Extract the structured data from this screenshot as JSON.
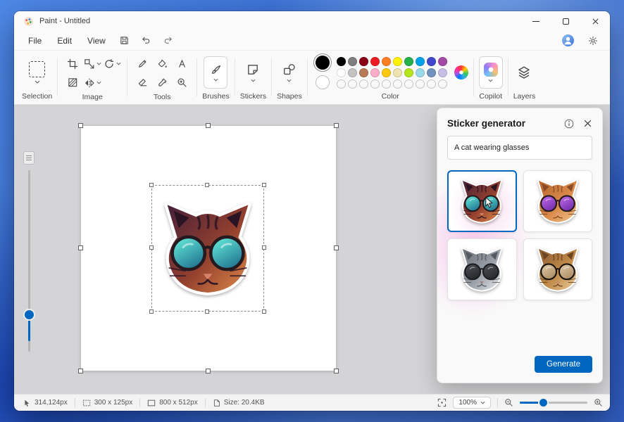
{
  "titlebar": {
    "title": "Paint - Untitled"
  },
  "menubar": {
    "items": [
      {
        "label": "File"
      },
      {
        "label": "Edit"
      },
      {
        "label": "View"
      }
    ]
  },
  "ribbon": {
    "group_labels": {
      "selection": "Selection",
      "image": "Image",
      "tools": "Tools",
      "brushes": "Brushes",
      "stickers": "Stickers",
      "shapes": "Shapes",
      "color": "Color",
      "copilot": "Copilot",
      "layers": "Layers"
    },
    "palette": {
      "foreground": "#000000",
      "background": "#ffffff",
      "row1": [
        "#000000",
        "#7f7f7f",
        "#880015",
        "#ed1c24",
        "#ff7f27",
        "#fff200",
        "#22b14c",
        "#00a2e8",
        "#3f48cc",
        "#a349a4"
      ],
      "row2": [
        "#ffffff",
        "#c3c3c3",
        "#b97a57",
        "#ffaec9",
        "#ffc90e",
        "#efe4b0",
        "#b5e61d",
        "#99d9ea",
        "#7092be",
        "#c8bfe7"
      ],
      "empty_slots": 10
    }
  },
  "sticker_panel": {
    "title": "Sticker generator",
    "prompt": "A cat wearing glasses",
    "generate_label": "Generate",
    "accent": "#0067c0",
    "results": [
      {
        "selected": true,
        "colors": {
          "fur_dark": "#46203a",
          "fur_mid": "#93402e",
          "fur_light": "#e08b4a",
          "ear": "#2a1322",
          "stripe": "#2e1524",
          "lens_top": "#63e9d9",
          "lens_bottom": "#1d6e8c",
          "frame": "#241a20",
          "nose": "#d9826b",
          "whisker": "#2e1524"
        }
      },
      {
        "selected": false,
        "colors": {
          "fur_dark": "#b5662f",
          "fur_mid": "#d98a4a",
          "fur_light": "#f2c38a",
          "ear": "#8a4a26",
          "stripe": "#8a4a26",
          "lens_top": "#c06ae8",
          "lens_bottom": "#6e2aa8",
          "frame": "#241a20",
          "nose": "#e09a7a",
          "whisker": "#6b3a1f"
        }
      },
      {
        "selected": false,
        "colors": {
          "fur_dark": "#6b7077",
          "fur_mid": "#9aa0a8",
          "fur_light": "#e8ebee",
          "ear": "#555a60",
          "stripe": "#555a60",
          "lens_top": "#4a4f55",
          "lens_bottom": "#23262a",
          "frame": "#1b1d20",
          "nose": "#9a7f86",
          "whisker": "#4a4f55"
        }
      },
      {
        "selected": false,
        "colors": {
          "fur_dark": "#8a5a2f",
          "fur_mid": "#c08a4a",
          "fur_light": "#ecd0a0",
          "ear": "#6b4422",
          "stripe": "#6b4422",
          "lens_top": "#e0c9a8",
          "lens_bottom": "#a8895f",
          "frame": "#17130f",
          "nose": "#c98a6b",
          "whisker": "#5a3a1c"
        }
      }
    ]
  },
  "canvas": {
    "sticker_colors": {
      "fur_dark": "#46203a",
      "fur_mid": "#93402e",
      "fur_light": "#e08b4a",
      "ear": "#2a1322",
      "stripe": "#2e1524",
      "lens_top": "#63e9d9",
      "lens_bottom": "#1d6e8c",
      "frame": "#241a20",
      "nose": "#d9826b",
      "whisker": "#2e1524"
    }
  },
  "statusbar": {
    "cursor_position": "314,124px",
    "selection_size": "300 x 125px",
    "canvas_size": "800 x 512px",
    "file_size": "Size: 20.4KB",
    "zoom_level": "100%"
  }
}
